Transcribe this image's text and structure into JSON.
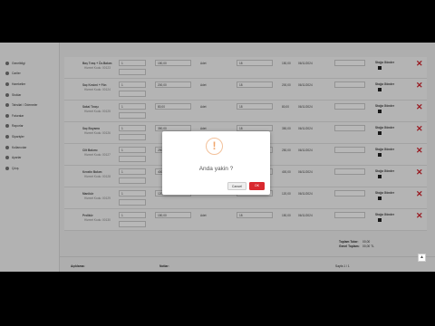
{
  "sidebar": {
    "items": [
      {
        "label": "Genelbilgi",
        "icon": "home-icon"
      },
      {
        "label": "Cariler",
        "icon": "users-icon"
      },
      {
        "label": "Hareketler",
        "icon": "list-icon"
      },
      {
        "label": "Stoklar",
        "icon": "box-icon"
      },
      {
        "label": "Tahsilat / Ödemeler",
        "icon": "wallet-icon"
      },
      {
        "label": "Faturalar",
        "icon": "invoice-icon"
      },
      {
        "label": "Raporlar",
        "icon": "chart-icon"
      },
      {
        "label": "Siparişler",
        "icon": "cart-icon"
      },
      {
        "label": "Kullanıcılar",
        "icon": "user-icon"
      },
      {
        "label": "Ayarlar",
        "icon": "gear-icon"
      },
      {
        "label": "Çıkış",
        "icon": "logout-icon"
      }
    ]
  },
  "table": {
    "rows": [
      {
        "name": "Baş Tıraş + Öz.Bakım",
        "sub": "Hizmet Kodu: 00123",
        "qty": "1",
        "price": "150,00",
        "unit": "Adet",
        "vat": "18",
        "amount": "150,00",
        "date": "06/11/2024",
        "status": "Stoğa Gönder"
      },
      {
        "name": "Saç Kesimi + Fön",
        "sub": "Hizmet Kodu: 00124",
        "qty": "1",
        "price": "200,00",
        "unit": "Adet",
        "vat": "18",
        "amount": "200,00",
        "date": "06/11/2024",
        "status": "Stoğa Gönder"
      },
      {
        "name": "Sakal Tıraşı",
        "sub": "Hizmet Kodu: 00125",
        "qty": "1",
        "price": "80,00",
        "unit": "Adet",
        "vat": "18",
        "amount": "80,00",
        "date": "06/11/2024",
        "status": "Stoğa Gönder"
      },
      {
        "name": "Saç Boyama",
        "sub": "Hizmet Kodu: 00126",
        "qty": "1",
        "price": "350,00",
        "unit": "Adet",
        "vat": "18",
        "amount": "350,00",
        "date": "06/11/2024",
        "status": "Stoğa Gönder"
      },
      {
        "name": "Cilt Bakımı",
        "sub": "Hizmet Kodu: 00127",
        "qty": "1",
        "price": "250,00",
        "unit": "Adet",
        "vat": "18",
        "amount": "250,00",
        "date": "06/11/2024",
        "status": "Stoğa Gönder"
      },
      {
        "name": "Keratin Bakım",
        "sub": "Hizmet Kodu: 00128",
        "qty": "1",
        "price": "400,00",
        "unit": "Adet",
        "vat": "18",
        "amount": "400,00",
        "date": "06/11/2024",
        "status": "Stoğa Gönder"
      },
      {
        "name": "Manikür",
        "sub": "Hizmet Kodu: 00129",
        "qty": "1",
        "price": "120,00",
        "unit": "Adet",
        "vat": "18",
        "amount": "120,00",
        "date": "06/11/2024",
        "status": "Stoğa Gönder"
      },
      {
        "name": "Pedikür",
        "sub": "Hizmet Kodu: 00130",
        "qty": "1",
        "price": "150,00",
        "unit": "Adet",
        "vat": "18",
        "amount": "150,00",
        "date": "06/11/2024",
        "status": "Stoğa Gönder"
      }
    ],
    "delete_glyph": "✕"
  },
  "summary": {
    "total_label": "Toplam Tutar:",
    "total_value": "00,00",
    "grand_label": "Genel Toplam:",
    "grand_value": "00,00 TL",
    "note_left": "Açıklama:",
    "note_mid": "Notlar:",
    "page_label": "Sayfa 1 / 1"
  },
  "modal": {
    "icon_glyph": "!",
    "title": "Anda yakin ?",
    "cancel_label": "Cancel",
    "ok_label": "OK",
    "accent": "#d9292f"
  },
  "scroll_top_glyph": "▲"
}
